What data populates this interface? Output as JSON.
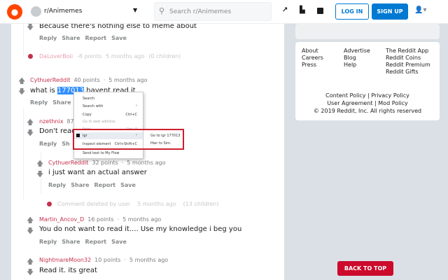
{
  "header": {
    "subreddit": "r/Animemes",
    "search_placeholder": "Search r/Animemes",
    "login": "LOG IN",
    "signup": "SIGN UP"
  },
  "comments": [
    {
      "text": "Because there's nothing else to meme about",
      "actions": [
        "Reply",
        "Share",
        "Report",
        "Save"
      ]
    },
    {
      "deleted": true,
      "user": "DaLoverBoii",
      "points": "-8 points",
      "time": "5 months ago",
      "children": "(0 children)"
    },
    {
      "user": "CythuerReddit",
      "points": "40 points",
      "time": "5 months ago",
      "text_before": "what is",
      "highlight": "177013",
      "text_after": "havent read it",
      "actions": [
        "Reply",
        "Share"
      ]
    },
    {
      "user": "nzethnix",
      "points": "87 p",
      "text": "Don't read",
      "actions": [
        "Reply",
        "Sh"
      ]
    },
    {
      "user": "CythuerReddit",
      "points": "32 points",
      "time": "5 months ago",
      "text": "i just want an actual answer",
      "actions": [
        "Reply",
        "Share",
        "Report",
        "Save"
      ]
    },
    {
      "deleted": true,
      "user": "Comment deleted by user",
      "time": "5 months ago",
      "children": "(13 children)"
    },
    {
      "user": "Martin_Ancov_D",
      "points": "16 points",
      "time": "5 months ago",
      "text": "You do not want to read it.... Use my knowledge i beg you",
      "actions": [
        "Reply",
        "Share",
        "Report",
        "Save"
      ]
    },
    {
      "user": "NightmareMoon32",
      "points": "10 points",
      "time": "5 months ago",
      "text": "Read it. its great"
    }
  ],
  "context_menu": {
    "items": [
      {
        "label": "Search"
      },
      {
        "label": "Search with",
        "arrow": "›"
      },
      {
        "label": "Copy",
        "key": "Ctrl+C"
      },
      {
        "label": "Go to web address"
      },
      {
        "label": "Print",
        "key": "Ctrl+P"
      },
      {
        "label": "igr",
        "arrow": "›"
      },
      {
        "label": "Inspect element",
        "key": "Ctrl+Shift+C"
      },
      {
        "label": "Send text to My Flow"
      }
    ],
    "submenu": [
      "Go to igr 177013",
      "Hier to Sim."
    ]
  },
  "footer": {
    "col1": [
      "About",
      "Careers",
      "Press"
    ],
    "col2": [
      "Advertise",
      "Blog",
      "Help"
    ],
    "col3": [
      "The Reddit App",
      "Reddit Coins",
      "Reddit Premium",
      "Reddit Gifts"
    ],
    "content_policy": "Content Policy |",
    "privacy_policy": "Privacy Policy",
    "user_agreement": "User Agreement |",
    "mod_policy": "Mod Policy",
    "copyright": "© 2019 Reddit, Inc. All rights reserved"
  },
  "back_to_top": "BACK TO TOP",
  "colors": {
    "accent": "#0079d3",
    "reddit": "#ff4500",
    "username": "#c6304c",
    "back_to_top": "#cc0a2c"
  }
}
